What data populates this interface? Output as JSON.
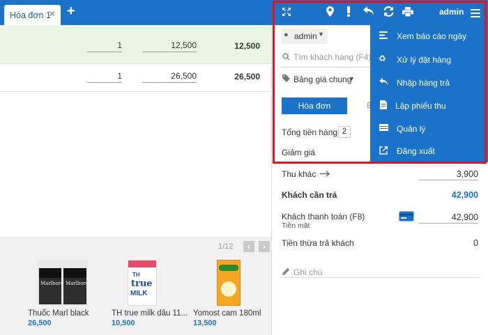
{
  "tab": {
    "label": "Hóa đơn 1",
    "close": "×",
    "add": "+"
  },
  "toolbar": {
    "user": "admin",
    "icons": [
      "fullscreen-icon",
      "location-icon",
      "alert-icon",
      "return-icon",
      "refresh-icon",
      "print-icon",
      "menu-icon"
    ]
  },
  "cart": {
    "rows": [
      {
        "qty": "1",
        "price": "12,500",
        "total": "12,500"
      },
      {
        "qty": "1",
        "price": "26,500",
        "total": "26,500"
      }
    ]
  },
  "products": {
    "page": "1/12",
    "items": [
      {
        "name": "Thuốc Marl black",
        "price": "26,500"
      },
      {
        "name": "TH true milk dâu 11...",
        "price": "10,500"
      },
      {
        "name": "Yomost cam 180ml",
        "price": "13,500"
      }
    ],
    "pack_text": "Marlboro",
    "milk_text": {
      "brand": "TH",
      "line1": "true",
      "line2": "MILK"
    }
  },
  "panel": {
    "seller": "admin",
    "search_placeholder": "Tìm khách hàng (F4)",
    "price_list": "Bảng giá chung",
    "invoice_tab": "Hóa đơn",
    "subtotal_label": "Tổng tiền hàng",
    "item_count": "2",
    "discount_label": "Giảm giá",
    "other_income_label": "Thu khác",
    "other_income_value": "3,900",
    "payable_label": "Khách cần trả",
    "payable_value": "42,900",
    "paid_label": "Khách thanh toán (F8)",
    "paid_method": "Tiền mặt",
    "paid_value": "42,900",
    "change_label": "Tiền thừa trả khách",
    "change_value": "0",
    "note_placeholder": "Ghi chú"
  },
  "menu": {
    "items": [
      {
        "label": "Xem báo cáo ngày",
        "icon": "report-icon"
      },
      {
        "label": "Xử lý đặt hàng",
        "icon": "recycle-icon"
      },
      {
        "label": "Nhập hàng trả",
        "icon": "return-goods-icon"
      },
      {
        "label": "Lập phiếu thu",
        "icon": "receipt-icon"
      },
      {
        "label": "Quản lý",
        "icon": "manage-icon"
      },
      {
        "label": "Đăng xuất",
        "icon": "logout-icon"
      }
    ]
  },
  "colors": {
    "primary": "#1a73c9",
    "highlight_border": "#e5121b",
    "selected_row": "#eaf5e4"
  }
}
